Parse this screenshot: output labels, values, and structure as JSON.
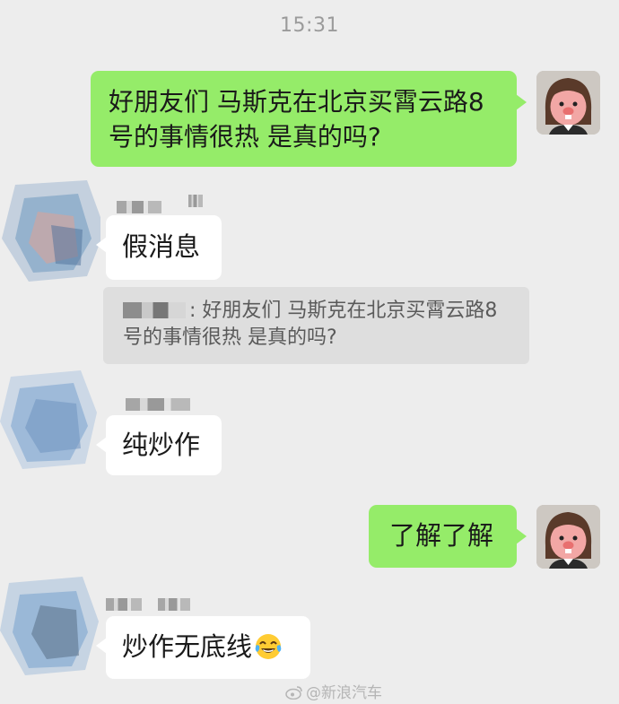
{
  "status": {
    "time": "15:31"
  },
  "messages": {
    "m1": {
      "text": "好朋友们 马斯克在北京买霄云路8号的事情很热 是真的吗?"
    },
    "m2": {
      "text": "假消息"
    },
    "m2_quote": {
      "text": ": 好朋友们 马斯克在北京买霄云路8号的事情很热 是真的吗?"
    },
    "m3": {
      "text": "纯炒作"
    },
    "m4": {
      "text": "了解了解"
    },
    "m5": {
      "text": "炒作无底线",
      "emoji": "tears-of-joy-emoji"
    }
  },
  "watermark": {
    "text": "@新浪汽车",
    "icon": "weibo-icon"
  },
  "colors": {
    "background": "#ededed",
    "outgoing_bubble": "#95ec69",
    "incoming_bubble": "#ffffff",
    "quote_bg": "#dedede"
  }
}
